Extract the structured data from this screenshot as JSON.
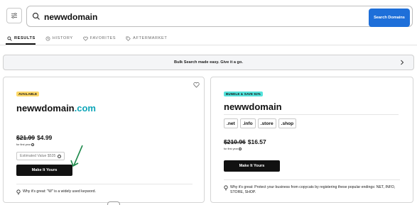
{
  "search": {
    "query": "newwdomain",
    "button_label": "Search Domains"
  },
  "tabs": [
    {
      "label": "RESULTS",
      "icon": "search-icon",
      "active": true
    },
    {
      "label": "HISTORY",
      "icon": "history-icon",
      "active": false
    },
    {
      "label": "FAVORITES",
      "icon": "heart-icon",
      "active": false
    },
    {
      "label": "AFTERMARKET",
      "icon": "tag-icon",
      "active": false
    }
  ],
  "banner": {
    "text": "Bulk Search made easy. Give it a go."
  },
  "left_card": {
    "badge": "AVAILABLE",
    "domain_name": "newwdomain",
    "domain_tld": ".com",
    "old_price": "$21.99",
    "price": "$4.99",
    "first_year": "for first year",
    "estimated_value": "Estimated Value $535",
    "button_label": "Make It Yours",
    "why": "Why it's great: \"W\" is a widely used keyword."
  },
  "right_card": {
    "badge": "BUNDLE & SAVE 92%",
    "domain_name": "newwdomain",
    "tlds": [
      ".net",
      ".info",
      ".store",
      ".shop"
    ],
    "old_price": "$210.96",
    "price": "$16.57",
    "first_year": "for first year",
    "button_label": "Make It Yours",
    "why": "Why it's great: Protect your business from copycats by registering these popular endings: NET, INFO, STORE, SHOP."
  },
  "colors": {
    "primary_button": "#1e6fd9",
    "available_badge": "#ffd96a",
    "bundle_badge": "#55e3dc",
    "tld_accent": "#0ea5b8",
    "arrow": "#1f8a4c"
  }
}
